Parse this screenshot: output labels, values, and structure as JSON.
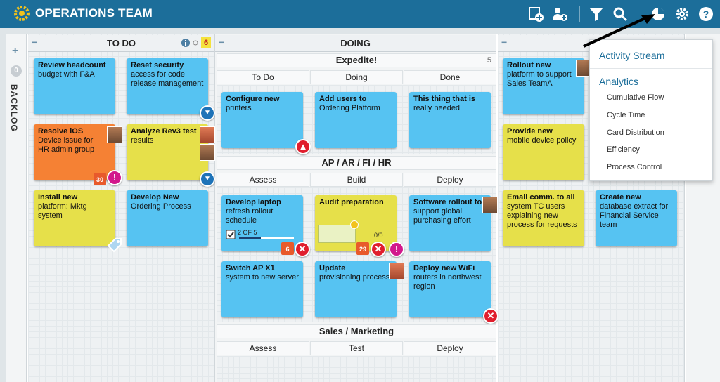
{
  "header": {
    "title": "OPERATIONS TEAM"
  },
  "backlog": {
    "count": "0",
    "label": "BACKLOG"
  },
  "todo": {
    "title": "TO DO",
    "wip": "6",
    "cards": [
      {
        "title": "Review headcount",
        "body": "budget with F&A"
      },
      {
        "title": "Reset security",
        "body": "access for code release management"
      },
      {
        "title": "Resolve iOS",
        "body": "Device issue for HR admin group"
      },
      {
        "title": "Analyze Rev3 test",
        "body": "results"
      },
      {
        "title": "Install new",
        "body": "platform: Mktg system"
      },
      {
        "title": "Develop New",
        "body": "Ordering Process"
      }
    ],
    "cal_date": "30"
  },
  "doing": {
    "title": "DOING",
    "expedite": {
      "title": "Expedite!",
      "count": "5",
      "cols": [
        "To Do",
        "Doing",
        "Done"
      ],
      "cards": [
        {
          "title": "Configure new",
          "body": "printers"
        },
        {
          "title": "Add users to",
          "body": "Ordering Platform"
        },
        {
          "title": "This thing that is",
          "body": "really needed"
        }
      ]
    },
    "ap": {
      "title": "AP / AR / FI / HR",
      "cols": [
        "Assess",
        "Build",
        "Deploy"
      ],
      "cards": [
        {
          "title": "Develop laptop",
          "body": "refresh rollout schedule"
        },
        {
          "title": "Audit preparation",
          "body": ""
        },
        {
          "title": "Software rollout to",
          "body": "support global purchasing effort"
        },
        {
          "title": "Switch AP X1",
          "body": "system to new server"
        },
        {
          "title": "Update",
          "body": "provisioning process"
        },
        {
          "title": "Deploy new WiFi",
          "body": "routers in northwest region"
        }
      ],
      "progress_text": "2 OF 5",
      "progress_fraction": 0.4,
      "audit_count": "0/0",
      "cal_a": "6",
      "cal_b": "29"
    },
    "sales": {
      "title": "Sales / Marketing",
      "cols": [
        "Assess",
        "Test",
        "Deploy"
      ]
    }
  },
  "done_lane": {
    "cards": [
      {
        "title": "Rollout new",
        "body": "platform to support Sales TeamA"
      },
      {
        "title": "Provide new",
        "body": "mobile device policy"
      },
      {
        "title": "Email comm. to all",
        "body": "system TC users explaining new process for requests"
      },
      {
        "title": "Create new",
        "body": "database extract for Financial Service team"
      }
    ]
  },
  "menu": {
    "activity": "Activity Stream",
    "analytics": "Analytics",
    "items": [
      "Cumulative Flow",
      "Cycle Time",
      "Card Distribution",
      "Efficiency",
      "Process Control"
    ]
  },
  "colors": {
    "header": "#1c6e9a",
    "card_blue": "#56c3f2",
    "card_yellow": "#e6e04a",
    "card_orange": "#f58134",
    "block_red": "#e01e2d",
    "priority_pink": "#d2188c"
  }
}
